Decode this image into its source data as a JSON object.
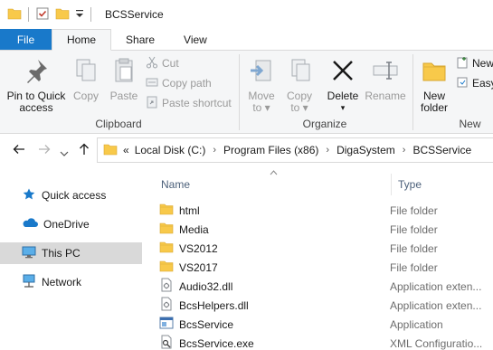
{
  "window": {
    "title": "BCSService"
  },
  "tabs": [
    {
      "label": "File"
    },
    {
      "label": "Home"
    },
    {
      "label": "Share"
    },
    {
      "label": "View"
    }
  ],
  "ribbon": {
    "clipboard": {
      "label": "Clipboard",
      "pin_label_1": "Pin to Quick",
      "pin_label_2": "access",
      "copy_label": "Copy",
      "paste_label": "Paste",
      "cut_label": "Cut",
      "copy_path_label": "Copy path",
      "paste_shortcut_label": "Paste shortcut"
    },
    "organize": {
      "label": "Organize",
      "move_to_label_1": "Move",
      "move_to_label_2": "to",
      "copy_to_label_1": "Copy",
      "copy_to_label_2": "to",
      "delete_label": "Delete",
      "rename_label": "Rename"
    },
    "new": {
      "label": "New",
      "new_folder_label_1": "New",
      "new_folder_label_2": "folder",
      "new_item_label": "New",
      "easy_access_label": "Easy"
    }
  },
  "address": {
    "overflow": "«",
    "crumbs": [
      "Local Disk (C:)",
      "Program Files (x86)",
      "DigaSystem",
      "BCSService"
    ]
  },
  "navpane": {
    "items": [
      {
        "label": "Quick access",
        "icon": "star-icon"
      },
      {
        "label": "OneDrive",
        "icon": "cloud-icon"
      },
      {
        "label": "This PC",
        "icon": "monitor-icon"
      },
      {
        "label": "Network",
        "icon": "network-icon"
      }
    ]
  },
  "filelist": {
    "columns": {
      "name": "Name",
      "type": "Type"
    },
    "rows": [
      {
        "name": "html",
        "type": "File folder",
        "icon": "folder-icon"
      },
      {
        "name": "Media",
        "type": "File folder",
        "icon": "folder-icon"
      },
      {
        "name": "VS2012",
        "type": "File folder",
        "icon": "folder-icon"
      },
      {
        "name": "VS2017",
        "type": "File folder",
        "icon": "folder-icon"
      },
      {
        "name": "Audio32.dll",
        "type": "Application exten...",
        "icon": "dll-icon"
      },
      {
        "name": "BcsHelpers.dll",
        "type": "Application exten...",
        "icon": "dll-icon"
      },
      {
        "name": "BcsService",
        "type": "Application",
        "icon": "app-icon"
      },
      {
        "name": "BcsService.exe",
        "type": "XML Configuratio...",
        "icon": "config-icon"
      }
    ]
  },
  "colors": {
    "file_tab": "#1979ca",
    "folder": "#f8c94a",
    "selected": "#d9d9d9"
  }
}
